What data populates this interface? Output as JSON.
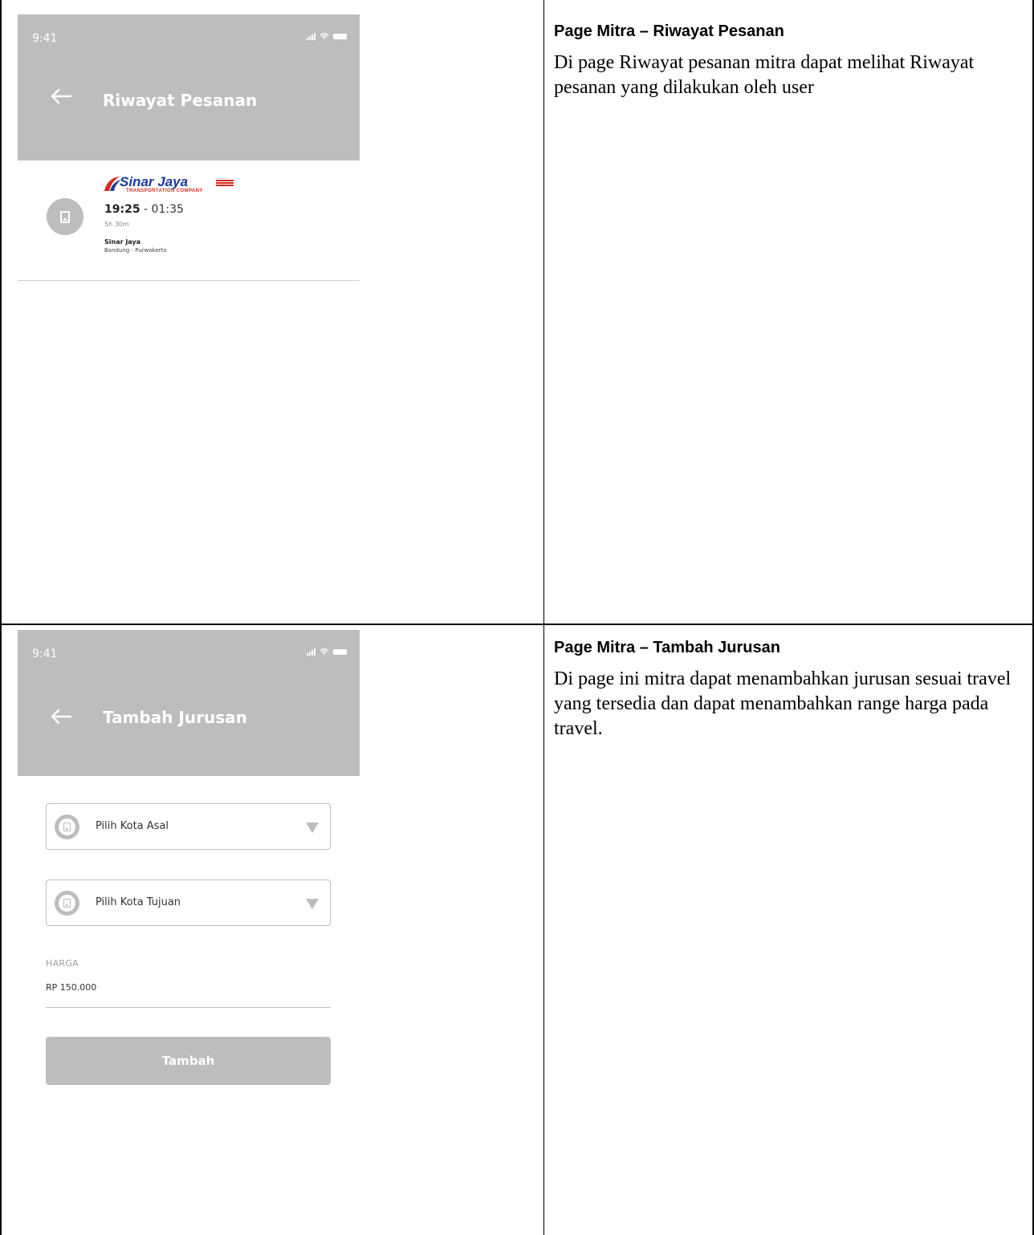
{
  "colors": {
    "appbar": "#bdbdbd",
    "placeholder_gray": "#bdbdbd",
    "logo_blue": "#1a3a9c",
    "logo_red": "#d62b1f"
  },
  "rows": [
    {
      "mockup": {
        "status_time": "9:41",
        "title": "Riwayat Pesanan",
        "order": {
          "logo_text": "Sinar Jaya",
          "logo_subtext": "TRANSPORTATION COMPANY",
          "depart_time": "19:25",
          "separator": " - ",
          "arrive_time": "01:35",
          "duration": "5h 30m",
          "operator": "Sinar Jaya",
          "route": "Bandung - Purwokerto"
        }
      },
      "description": {
        "title": "Page Mitra – Riwayat Pesanan",
        "body": "Di page Riwayat pesanan mitra dapat melihat Riwayat pesanan yang dilakukan oleh user"
      }
    },
    {
      "mockup": {
        "status_time": "9:41",
        "title": "Tambah Jurusan",
        "origin_placeholder": "Pilih Kota Asal",
        "destination_placeholder": "Pilih Kota Tujuan",
        "price_label": "HARGA",
        "price_value": "RP 150.000",
        "submit_label": "Tambah"
      },
      "description": {
        "title": "Page Mitra – Tambah Jurusan",
        "body": "Di page ini mitra dapat menambahkan jurusan sesuai travel yang tersedia dan dapat menambahkan range harga pada travel."
      }
    }
  ]
}
